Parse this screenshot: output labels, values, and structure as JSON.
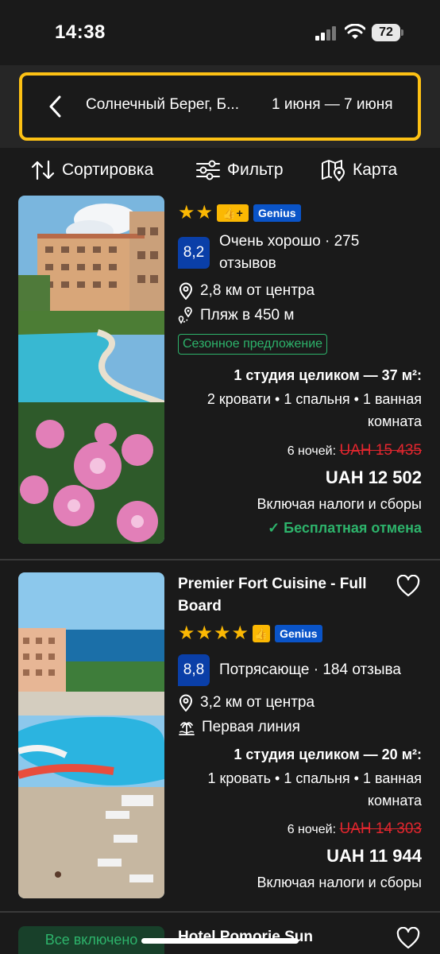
{
  "status": {
    "time": "14:38",
    "battery": "72"
  },
  "search": {
    "destination": "Солнечный Берег, Б...",
    "dates": "1 июня — 7 июня"
  },
  "toolbar": {
    "sort_label": "Сортировка",
    "filter_label": "Фильтр",
    "map_label": "Карта"
  },
  "hotels": [
    {
      "stars": 2,
      "preferred_badge": "👍+",
      "genius": "Genius",
      "score": "8,2",
      "review_text": "Очень хорошо · 275 отзывов",
      "distance": "2,8 км от центра",
      "beach": "Пляж в 450 м",
      "deal": "Сезонное предложение",
      "room_title": "1 студия целиком — 37 м²:",
      "room_detail": "2 кровати • 1 спальня • 1 ванная комната",
      "nights": "6 ночей:",
      "old_price": "UAH 15 435",
      "price": "UAH 12 502",
      "taxes": "Включая налоги и сборы",
      "cancellation": "✓ Бесплатная отмена"
    },
    {
      "name": "Premier Fort Cuisine - Full Board",
      "stars": 4,
      "preferred_badge": "👍",
      "genius": "Genius",
      "score": "8,8",
      "review_text": "Потрясающе · 184 отзыва",
      "distance": "3,2 км от центра",
      "beach": "Первая линия",
      "room_title": "1 студия целиком — 20 м²:",
      "room_detail": "1 кровать • 1 спальня • 1 ванная комната",
      "nights": "6 ночей:",
      "old_price": "UAH 14 303",
      "price": "UAH 11 944",
      "taxes": "Включая налоги и сборы"
    },
    {
      "name": "Hotel Pomorie Sun",
      "badge": "Все включено"
    }
  ],
  "colors": {
    "accent_yellow": "#fdc114",
    "score_blue": "#0a3fa8",
    "green": "#2db36b",
    "strike_red": "#e2262e"
  }
}
